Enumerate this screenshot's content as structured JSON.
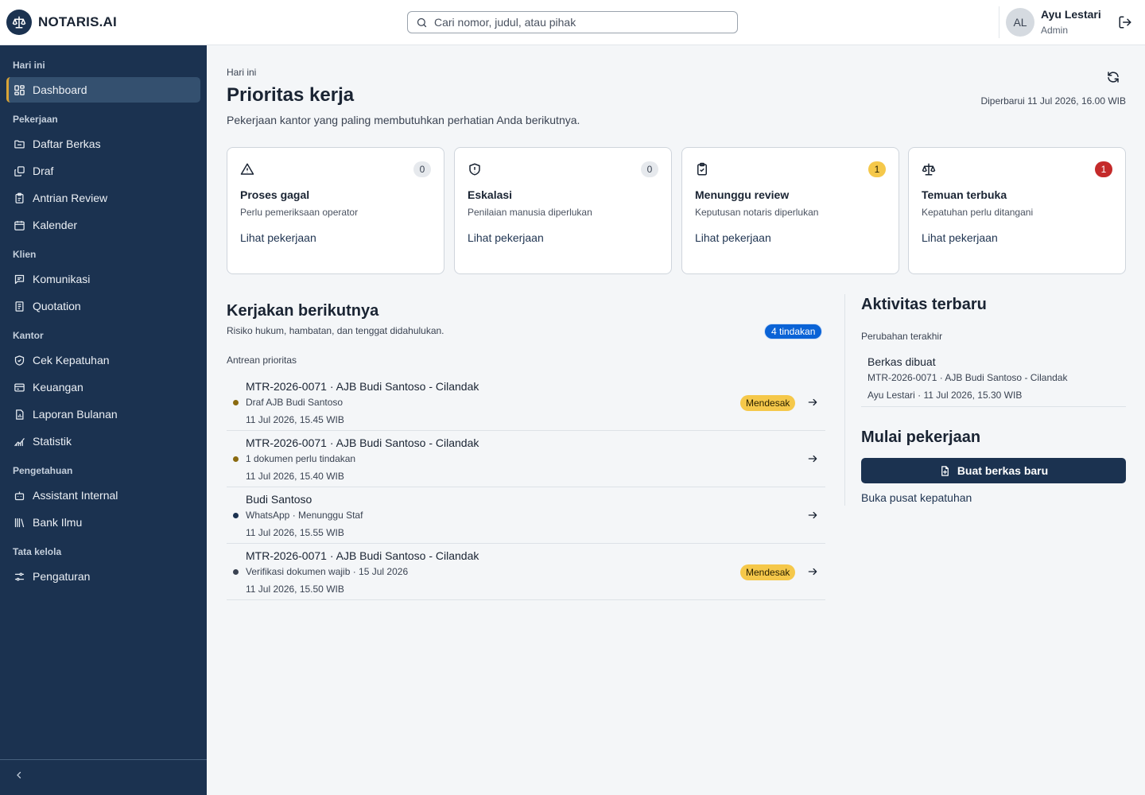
{
  "app": {
    "name": "NOTARIS.AI"
  },
  "search": {
    "placeholder": "Cari nomor, judul, atau pihak"
  },
  "user": {
    "initials": "AL",
    "name": "Ayu Lestari",
    "role": "Admin"
  },
  "sidebar": {
    "groups": [
      {
        "label": "Hari ini",
        "items": [
          {
            "label": "Dashboard",
            "icon": "dashboard-icon",
            "active": true
          }
        ]
      },
      {
        "label": "Pekerjaan",
        "items": [
          {
            "label": "Daftar Berkas",
            "icon": "folder-icon"
          },
          {
            "label": "Draf",
            "icon": "copy-icon"
          },
          {
            "label": "Antrian Review",
            "icon": "clipboard-icon"
          },
          {
            "label": "Kalender",
            "icon": "calendar-icon"
          }
        ]
      },
      {
        "label": "Klien",
        "items": [
          {
            "label": "Komunikasi",
            "icon": "message-icon"
          },
          {
            "label": "Quotation",
            "icon": "receipt-icon"
          }
        ]
      },
      {
        "label": "Kantor",
        "items": [
          {
            "label": "Cek Kepatuhan",
            "icon": "shield-check-icon"
          },
          {
            "label": "Keuangan",
            "icon": "wallet-icon"
          },
          {
            "label": "Laporan Bulanan",
            "icon": "report-icon"
          },
          {
            "label": "Statistik",
            "icon": "chart-line-icon"
          }
        ]
      },
      {
        "label": "Pengetahuan",
        "items": [
          {
            "label": "Assistant Internal",
            "icon": "bot-icon"
          },
          {
            "label": "Bank Ilmu",
            "icon": "library-icon"
          }
        ]
      },
      {
        "label": "Tata kelola",
        "items": [
          {
            "label": "Pengaturan",
            "icon": "settings-icon"
          }
        ]
      }
    ]
  },
  "page": {
    "breadcrumb": "Hari ini",
    "title": "Prioritas kerja",
    "subtitle": "Pekerjaan kantor yang paling membutuhkan perhatian Anda berikutnya.",
    "updated": "Diperbarui 11 Jul 2026, 16.00 WIB"
  },
  "cards": [
    {
      "title": "Proses gagal",
      "subtitle": "Perlu pemeriksaan operator",
      "count": "0",
      "link": "Lihat pekerjaan",
      "icon": "alert-triangle-icon",
      "count_bg": "#e6e9ed",
      "count_fg": "#3a4352"
    },
    {
      "title": "Eskalasi",
      "subtitle": "Penilaian manusia diperlukan",
      "count": "0",
      "link": "Lihat pekerjaan",
      "icon": "shield-alert-icon",
      "count_bg": "#e6e9ed",
      "count_fg": "#3a4352"
    },
    {
      "title": "Menunggu review",
      "subtitle": "Keputusan notaris diperlukan",
      "count": "1",
      "link": "Lihat pekerjaan",
      "icon": "clipboard-check-icon",
      "count_bg": "#f5c84a",
      "count_fg": "#2a2100"
    },
    {
      "title": "Temuan terbuka",
      "subtitle": "Kepatuhan perlu ditangani",
      "count": "1",
      "link": "Lihat pekerjaan",
      "icon": "scale-icon",
      "count_bg": "#c42a2a",
      "count_fg": "#ffffff"
    }
  ],
  "next": {
    "title": "Kerjakan berikutnya",
    "subtitle": "Risiko hukum, hambatan, dan tenggat didahulukan.",
    "badge": "4 tindakan",
    "queue_label": "Antrean prioritas",
    "rows": [
      {
        "title": "MTR-2026-0071 · AJB Budi Santoso - Cilandak",
        "subtitle": "Draf AJB Budi Santoso",
        "time": "11 Jul 2026, 15.45 WIB",
        "urgent": "Mendesak",
        "dot": "#8a6a10"
      },
      {
        "title": "MTR-2026-0071 · AJB Budi Santoso - Cilandak",
        "subtitle": "1 dokumen perlu tindakan",
        "time": "11 Jul 2026, 15.40 WIB",
        "urgent": "",
        "dot": "#8a6a10"
      },
      {
        "title": "Budi Santoso",
        "subtitle": "WhatsApp · Menunggu Staf",
        "time": "11 Jul 2026, 15.55 WIB",
        "urgent": "",
        "dot": "#1b3250"
      },
      {
        "title": "MTR-2026-0071 · AJB Budi Santoso - Cilandak",
        "subtitle": "Verifikasi dokumen wajib · 15 Jul 2026",
        "time": "11 Jul 2026, 15.50 WIB",
        "urgent": "Mendesak",
        "dot": "#3a4352"
      }
    ]
  },
  "activity": {
    "title": "Aktivitas terbaru",
    "label": "Perubahan terakhir",
    "item": {
      "title": "Berkas dibuat",
      "ref": "MTR-2026-0071 · AJB Budi Santoso - Cilandak",
      "meta": "Ayu Lestari · 11 Jul 2026, 15.30 WIB"
    }
  },
  "start": {
    "title": "Mulai pekerjaan",
    "button": "Buat berkas baru",
    "link": "Buka pusat kepatuhan"
  },
  "colors": {
    "sidebar": "#1b3250",
    "accent": "#d8a336",
    "primary_blue": "#0a63d6",
    "urgent": "#f5c84a",
    "danger": "#c42a2a"
  }
}
